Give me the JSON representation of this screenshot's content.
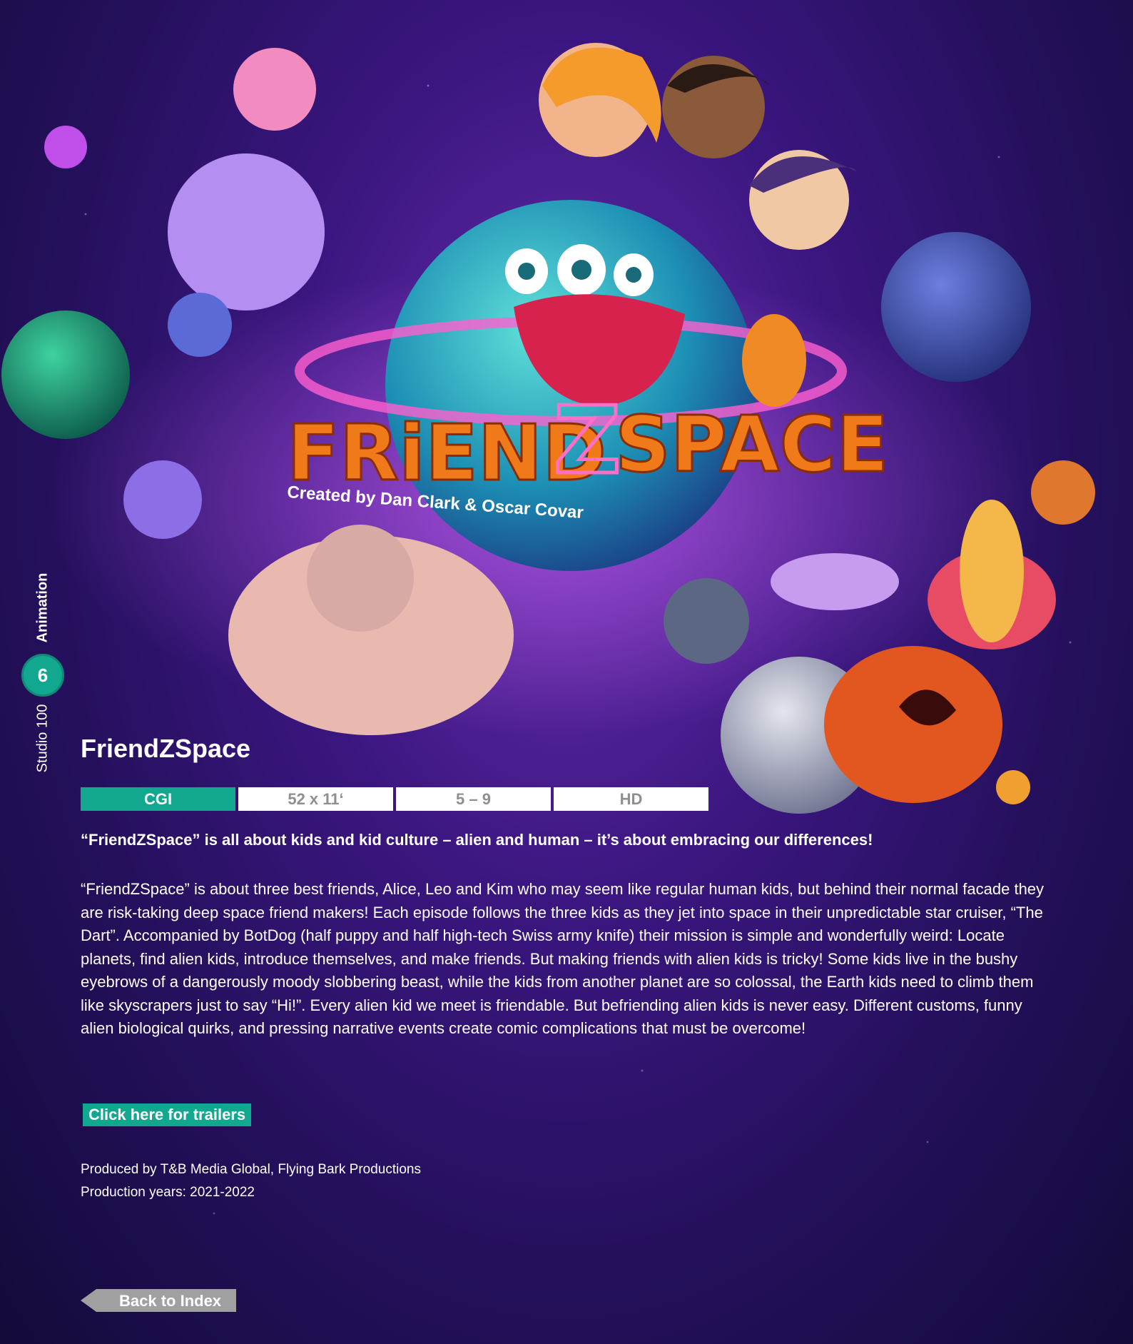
{
  "rail": {
    "section": "Animation",
    "page_number": "6",
    "brand": "Studio 100"
  },
  "hero": {
    "logo_part1": "FRiEND",
    "logo_z": "Z",
    "logo_part2": "SPACE",
    "created_by": "Created by Dan Clark & Oscar Covar"
  },
  "show": {
    "title": "FriendZSpace",
    "tags": [
      "CGI",
      "52 x 11‘",
      "5 – 9",
      "HD"
    ],
    "tagline": "“FriendZSpace” is all about kids and kid culture – alien and human – it’s about embracing our differences!",
    "description": "“FriendZSpace” is about three best friends, Alice, Leo and Kim who may seem like regular human kids, but behind their normal facade they are risk-taking deep space friend makers! Each episode follows the three kids as they jet into space in their unpredictable star cruiser, “The Dart”. Accompanied by BotDog (half puppy and half high-tech Swiss army knife) their mission is simple and wonderfully weird: Locate planets, find alien kids, introduce themselves, and make friends. But making friends with alien kids is tricky! Some kids live in the bushy eyebrows of a dangerously moody slobbering beast, while the kids from another planet are so colossal, the Earth kids need to climb them like skyscrapers just to say “Hi!”. Every alien kid we meet is friendable. But befriending alien kids is never easy. Different customs, funny alien biological quirks, and pressing narrative events create comic complications that must be overcome!",
    "trailer_label": "Click here for trailers",
    "produced_by": "Produced by T&B Media Global, Flying Bark Productions",
    "production_years": "Production years: 2021-2022"
  },
  "nav": {
    "back_label": "Back to Index"
  },
  "colors": {
    "accent": "#12a88f",
    "logo_orange": "#f07a1a",
    "background": "#3b1680"
  }
}
